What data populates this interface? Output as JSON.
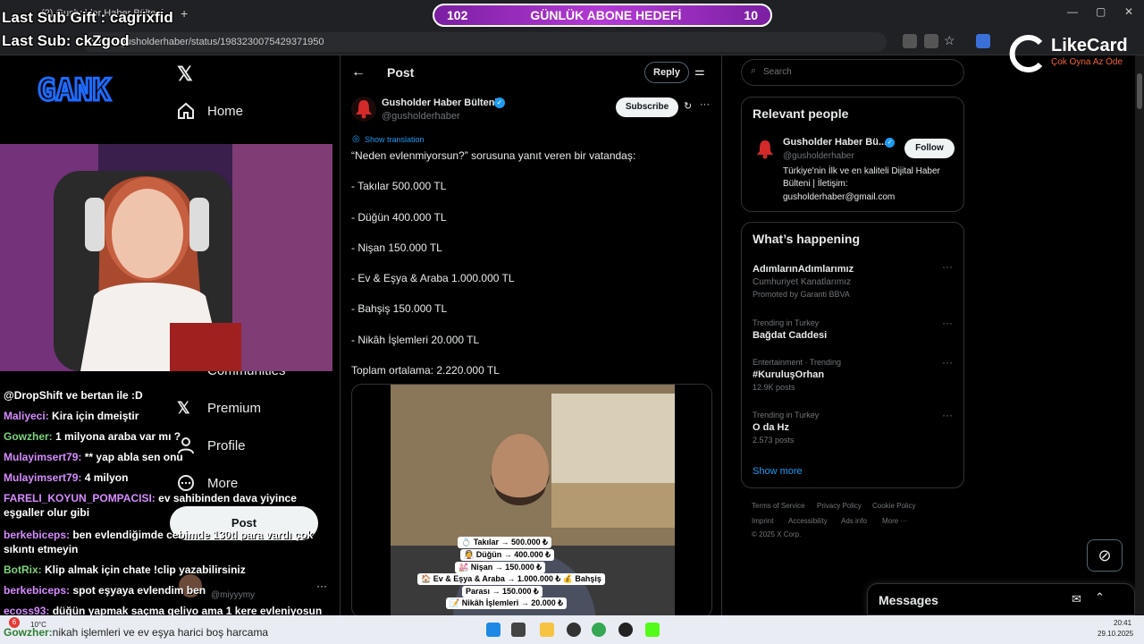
{
  "browser": {
    "tab_title": "(2) Gusholder Haber Bülteni...",
    "url": "x.com/gusholderhaber/status/1983230075429371950"
  },
  "overlay": {
    "last_sub_gift": "Last Sub Gift : cagrixfid",
    "last_sub": "Last Sub: ckZgod",
    "goal_left": "102",
    "goal_title": "GÜNLÜK ABONE HEDEFİ",
    "goal_right": "10",
    "gank_logo": "GANK",
    "likecard_name": "LikeCard",
    "likecard_slogan": "Çok Oyna Az Öde"
  },
  "nav": {
    "home": "Home",
    "communities": "Communities",
    "premium": "Premium",
    "profile": "Profile",
    "more": "More",
    "post_button": "Post",
    "account_handle": "@miyyymy"
  },
  "chat": [
    {
      "user": "@DropShift ve bertan ile :D",
      "msg": "",
      "color": "#ffffff"
    },
    {
      "user": "Maliyeci:",
      "msg": "Kira için dmeiştir",
      "color": "#d58cff"
    },
    {
      "user": "Gowzher:",
      "msg": "1 milyona araba var mı ?",
      "color": "#7fd37f"
    },
    {
      "user": "Mulayimsert79:",
      "msg": "** yap abla sen onu",
      "color": "#d58cff"
    },
    {
      "user": "Mulayimsert79:",
      "msg": "4 milyon",
      "color": "#d58cff"
    },
    {
      "user": "FARELI_KOYUN_POMPACISI:",
      "msg": "ev sahibinden dava yiyince eşgaller olur gibi",
      "color": "#d58cff"
    },
    {
      "user": "berkebiceps:",
      "msg": "ben evlendiğimde cebimde 130tl para vardı çok sıkıntı etmeyin",
      "color": "#d58cff"
    },
    {
      "user": "BotRix:",
      "msg": "Klip almak için chate !clip yazabilirsiniz",
      "color": "#7fd37f"
    },
    {
      "user": "berkebiceps:",
      "msg": "spot eşyaya evlendim ben",
      "color": "#d58cff"
    },
    {
      "user": "ecoss93:",
      "msg": "düğün yapmak saçma geliyo ama 1 kere evleniyosun",
      "color": "#d58cff"
    },
    {
      "user": "Gowzher:",
      "msg": "nikah işlemleri ve ev eşya harici boş harcama",
      "color": "#7fd37f"
    }
  ],
  "post": {
    "header_title": "Post",
    "reply_button": "Reply",
    "author_name": "Gusholder Haber Bülteni",
    "author_handle": "@gusholderhaber",
    "subscribe_button": "Subscribe",
    "show_translation": "Show translation",
    "lines": [
      "“Neden evlenmiyorsun?” sorusuna yanıt veren bir vatandaş:",
      "- Takılar 500.000 TL",
      "- Düğün 400.000 TL",
      "- Nişan 150.000 TL",
      "- Ev & Eşya & Araba 1.000.000 TL",
      "- Bahşiş 150.000 TL",
      "- Nikâh İşlemleri 20.000 TL",
      "Toplam ortalama: 2.220.000 TL"
    ],
    "video_captions": [
      "💍 Takılar → 500.000 ₺",
      "👰 Düğün → 400.000 ₺",
      "💒 Nişan → 150.000 ₺",
      "🏠 Ev & Eşya & Araba → 1.000.000 ₺ 💰 Bahşiş",
      "Parası → 150.000 ₺",
      "📝 Nikâh İşlemleri → 20.000 ₺"
    ]
  },
  "sidebar": {
    "search_placeholder": "Search",
    "relevant_title": "Relevant people",
    "rp_name": "Gusholder Haber Bü...",
    "rp_handle": "@gusholderhaber",
    "rp_follow": "Follow",
    "rp_bio_1": "Türkiye'nin İlk ve en kaliteli Dijital Haber",
    "rp_bio_2": "Bülteni | İletişim:",
    "rp_bio_3": "gusholderhaber@gmail.com",
    "happening_title": "What’s happening",
    "trends": [
      {
        "context": "",
        "name": "AdımlarınAdımlarımız",
        "sub": "Cumhuriyet Kanatlarımız",
        "extra": "Promoted by Garanti BBVA"
      },
      {
        "context": "Trending in Turkey",
        "name": "Bağdat Caddesi",
        "sub": "",
        "extra": ""
      },
      {
        "context": "Entertainment · Trending",
        "name": "#KuruluşOrhan",
        "sub": "12.9K posts",
        "extra": ""
      },
      {
        "context": "Trending in Turkey",
        "name": "O da Hz",
        "sub": "2.573 posts",
        "extra": ""
      }
    ],
    "show_more": "Show more",
    "footer": [
      "Terms of Service",
      "Privacy Policy",
      "Cookie Policy",
      "Imprint",
      "Accessibility",
      "Ads info",
      "More ···",
      "© 2025 X Corp."
    ],
    "messages": "Messages"
  },
  "taskbar": {
    "weather": "10°C",
    "notif_count": "6",
    "time": "20:41",
    "date": "29.10.2025"
  },
  "colors": {
    "x_blue": "#1d9bf0",
    "goal_purple": "#9c27b0"
  }
}
